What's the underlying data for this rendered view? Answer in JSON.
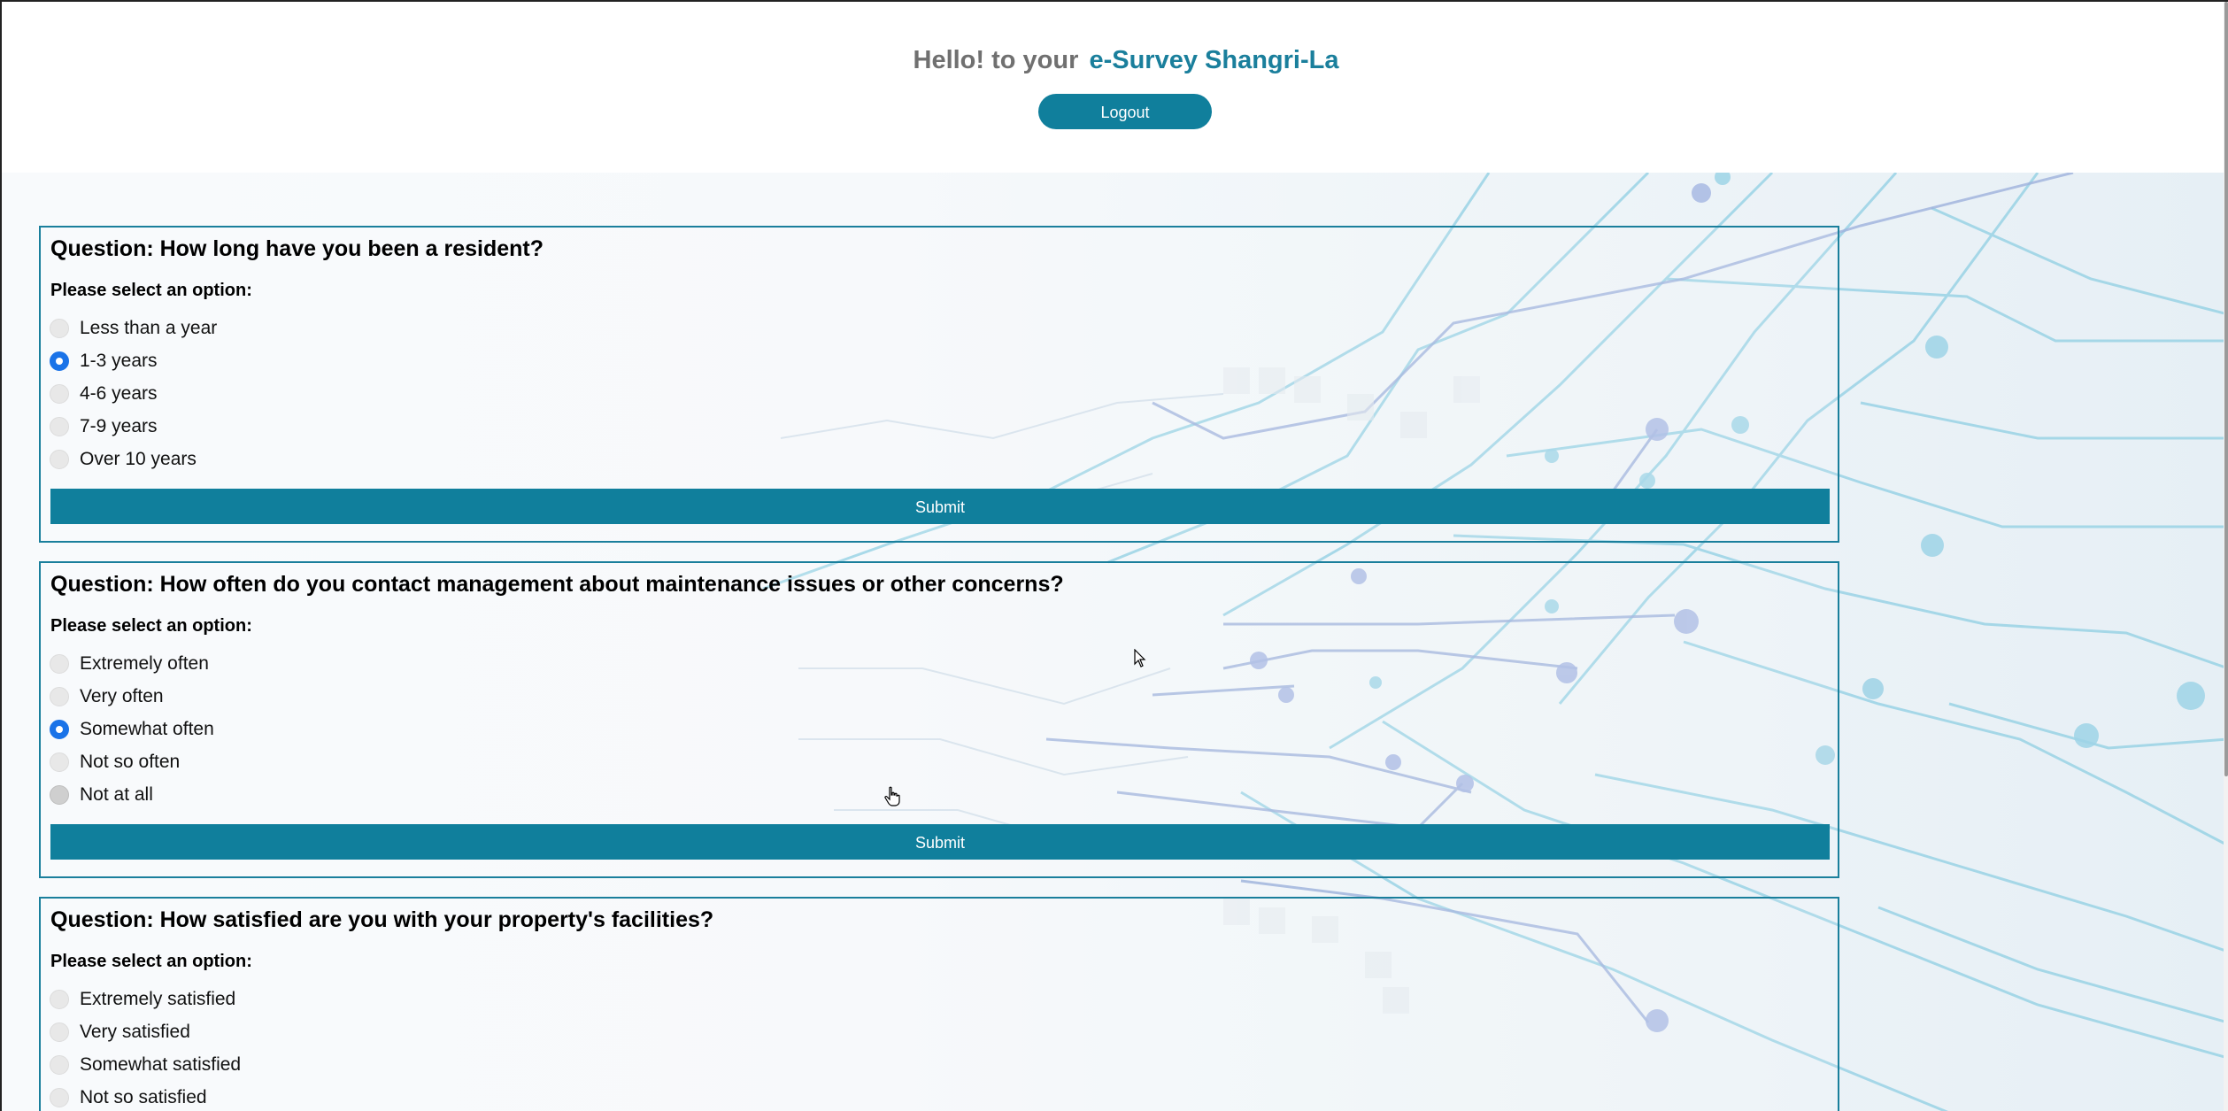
{
  "header": {
    "greeting": "Hello! to your",
    "brand": "e-Survey Shangri-La",
    "logout_label": "Logout"
  },
  "questions": [
    {
      "title": "Question: How long have you been a resident?",
      "prompt": "Please select an option:",
      "options": [
        "Less than a year",
        "1-3 years",
        "4-6 years",
        "7-9 years",
        "Over 10 years"
      ],
      "selected": "1-3 years",
      "submit_label": "Submit"
    },
    {
      "title": "Question: How often do you contact management about maintenance issues or other concerns?",
      "prompt": "Please select an option:",
      "options": [
        "Extremely often",
        "Very often",
        "Somewhat often",
        "Not so often",
        "Not at all"
      ],
      "selected": "Somewhat often",
      "submit_label": "Submit"
    },
    {
      "title": "Question: How satisfied are you with your property's facilities?",
      "prompt": "Please select an option:",
      "options": [
        "Extremely satisfied",
        "Very satisfied",
        "Somewhat satisfied",
        "Not so satisfied"
      ],
      "selected": null
    }
  ],
  "colors": {
    "accent": "#107f9c",
    "brand_text": "#1a7f9c",
    "greeting_text": "#707070",
    "radio_checked": "#1a73e8"
  }
}
